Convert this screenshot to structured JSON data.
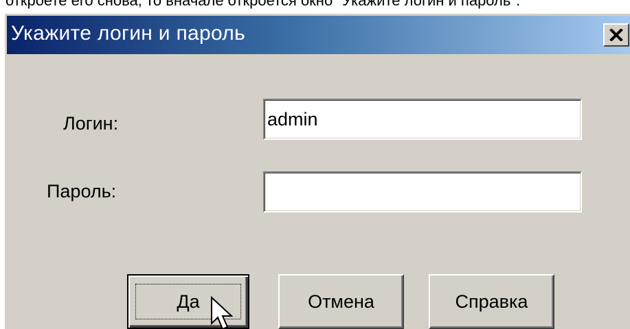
{
  "page_caption": "откроете его снова, то вначале откроется окно \"Укажите логин и пароль\".",
  "dialog": {
    "title": "Укажите логин и пароль",
    "close_icon": "close-icon",
    "login_label": "Логин:",
    "login_value": "admin",
    "password_label": "Пароль:",
    "password_value": "",
    "buttons": {
      "ok": "Да",
      "cancel": "Отмена",
      "help": "Справка"
    }
  },
  "cursor_icon": "arrow-pointer-icon",
  "colors": {
    "titlebar_start": "#0a246a",
    "titlebar_end": "#a6caf0",
    "dialog_face": "#d4d0c8"
  }
}
